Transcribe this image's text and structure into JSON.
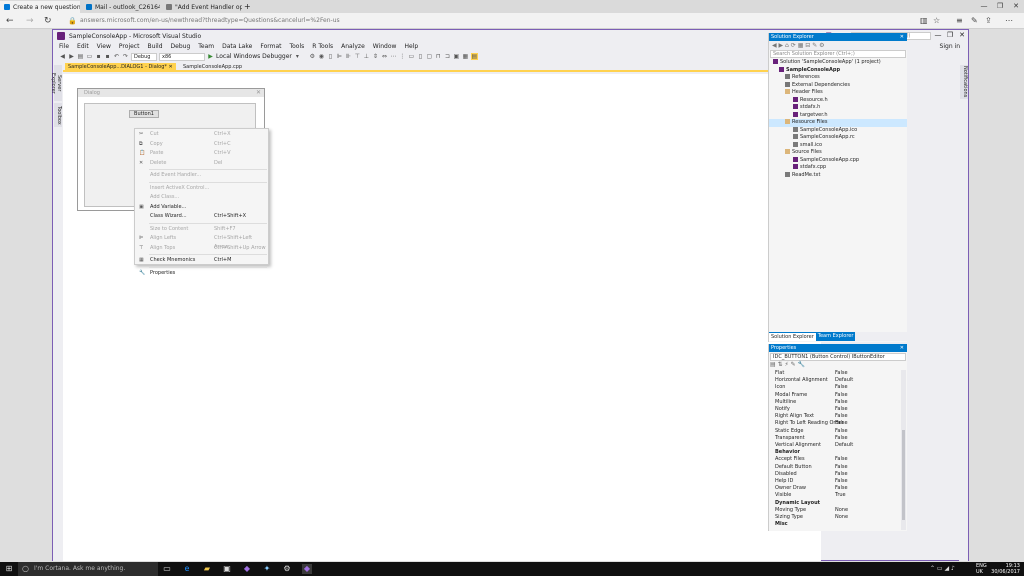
{
  "browser": {
    "tabs": [
      {
        "label": "Create a new question o",
        "color": "#0078d7"
      },
      {
        "label": "Mail - outlook_C261642784",
        "color": "#0072c6"
      },
      {
        "label": "\"Add Event Handler option",
        "color": "#777777"
      }
    ],
    "new_tab": "+",
    "url": "answers.microsoft.com/en-us/newthread?threadtype=Questions&cancelurl=%2Fen-us",
    "win_controls": [
      "—",
      "❐",
      "✕"
    ]
  },
  "vs": {
    "title": "SampleConsoleApp - Microsoft Visual Studio",
    "quick_launch": "Quick Launch (Ctrl+Q)",
    "sign_in": "Sign in",
    "menu": [
      "File",
      "Edit",
      "View",
      "Project",
      "Build",
      "Debug",
      "Team",
      "Data Lake",
      "Format",
      "Tools",
      "R Tools",
      "Analyze",
      "Window",
      "Help"
    ],
    "toolbar": {
      "config": "Debug",
      "platform": "x86",
      "run": "Local Windows Debugger"
    },
    "side_tabs": [
      "Server Explorer",
      "Toolbox"
    ],
    "right_tab": "Notifications",
    "doc_tabs": [
      "SampleConsoleApp...DIALOG1 - Dialog*",
      "SampleConsoleApp.cpp"
    ],
    "dialog": {
      "title": "Dialog",
      "button": "Button1"
    },
    "context_menu": [
      {
        "label": "Cut",
        "shortcut": "Ctrl+X",
        "disabled": true,
        "icon": "✂"
      },
      {
        "label": "Copy",
        "shortcut": "Ctrl+C",
        "disabled": true,
        "icon": "⧉"
      },
      {
        "label": "Paste",
        "shortcut": "Ctrl+V",
        "disabled": true,
        "icon": "📋"
      },
      {
        "label": "Delete",
        "shortcut": "Del",
        "disabled": true,
        "icon": "✕"
      },
      {
        "sep": true
      },
      {
        "label": "Add Event Handler...",
        "shortcut": "",
        "disabled": true,
        "icon": ""
      },
      {
        "sep": true
      },
      {
        "label": "Insert ActiveX Control...",
        "shortcut": "",
        "disabled": true,
        "icon": ""
      },
      {
        "label": "Add Class...",
        "shortcut": "",
        "disabled": true,
        "icon": ""
      },
      {
        "label": "Add Variable...",
        "shortcut": "",
        "disabled": false,
        "icon": "▣"
      },
      {
        "label": "Class Wizard...",
        "shortcut": "Ctrl+Shift+X",
        "disabled": false,
        "icon": ""
      },
      {
        "sep": true
      },
      {
        "label": "Size to Content",
        "shortcut": "Shift+F7",
        "disabled": true,
        "icon": ""
      },
      {
        "label": "Align Lefts",
        "shortcut": "Ctrl+Shift+Left Arrow",
        "disabled": true,
        "icon": "⊫"
      },
      {
        "label": "Align Tops",
        "shortcut": "Ctrl+Shift+Up Arrow",
        "disabled": true,
        "icon": "⊤"
      },
      {
        "sep": true
      },
      {
        "label": "Check Mnemonics",
        "shortcut": "Ctrl+M",
        "disabled": false,
        "icon": "▦"
      },
      {
        "sep": true
      },
      {
        "label": "Properties",
        "shortcut": "",
        "disabled": false,
        "icon": "🔧"
      }
    ],
    "solution_explorer": {
      "title": "Solution Explorer",
      "search": "Search Solution Explorer (Ctrl+;)",
      "tree": [
        {
          "label": "Solution 'SampleConsoleApp' (1 project)",
          "level": 0,
          "color": "#68217a",
          "bold": false,
          "sel": false
        },
        {
          "label": "SampleConsoleApp",
          "level": 1,
          "color": "#68217a",
          "bold": true,
          "sel": false
        },
        {
          "label": "References",
          "level": 2,
          "color": "#777777",
          "bold": false,
          "sel": false
        },
        {
          "label": "External Dependencies",
          "level": 2,
          "color": "#777777",
          "bold": false,
          "sel": false
        },
        {
          "label": "Header Files",
          "level": 2,
          "color": "#dcb67a",
          "bold": false,
          "sel": false
        },
        {
          "label": "Resource.h",
          "level": 3,
          "color": "#68217a",
          "bold": false,
          "sel": false
        },
        {
          "label": "stdafx.h",
          "level": 3,
          "color": "#68217a",
          "bold": false,
          "sel": false
        },
        {
          "label": "targetver.h",
          "level": 3,
          "color": "#68217a",
          "bold": false,
          "sel": false
        },
        {
          "label": "Resource Files",
          "level": 2,
          "color": "#dcb67a",
          "bold": false,
          "sel": true
        },
        {
          "label": "SampleConsoleApp.ico",
          "level": 3,
          "color": "#7a7a7a",
          "bold": false,
          "sel": false
        },
        {
          "label": "SampleConsoleApp.rc",
          "level": 3,
          "color": "#7a7a7a",
          "bold": false,
          "sel": false
        },
        {
          "label": "small.ico",
          "level": 3,
          "color": "#7a7a7a",
          "bold": false,
          "sel": false
        },
        {
          "label": "Source Files",
          "level": 2,
          "color": "#dcb67a",
          "bold": false,
          "sel": false
        },
        {
          "label": "SampleConsoleApp.cpp",
          "level": 3,
          "color": "#68217a",
          "bold": false,
          "sel": false
        },
        {
          "label": "stdafx.cpp",
          "level": 3,
          "color": "#68217a",
          "bold": false,
          "sel": false
        },
        {
          "label": "ReadMe.txt",
          "level": 2,
          "color": "#7a7a7a",
          "bold": false,
          "sel": false
        }
      ],
      "tabs": [
        "Solution Explorer",
        "Team Explorer"
      ]
    },
    "properties": {
      "title": "Properties",
      "object": "IDC_BUTTON1 (Button Control)  IButtonEditor",
      "rows": [
        {
          "name": "Flat",
          "value": "False"
        },
        {
          "name": "Horizontal Alignment",
          "value": "Default"
        },
        {
          "name": "Icon",
          "value": "False"
        },
        {
          "name": "Modal Frame",
          "value": "False"
        },
        {
          "name": "Multiline",
          "value": "False"
        },
        {
          "name": "Notify",
          "value": "False"
        },
        {
          "name": "Right Align Text",
          "value": "False"
        },
        {
          "name": "Right To Left Reading Order",
          "value": "False"
        },
        {
          "name": "Static Edge",
          "value": "False"
        },
        {
          "name": "Transparent",
          "value": "False"
        },
        {
          "name": "Vertical Alignment",
          "value": "Default"
        },
        {
          "name": "Behavior",
          "value": "",
          "cat": true
        },
        {
          "name": "Accept Files",
          "value": "False"
        },
        {
          "name": "Default Button",
          "value": "False"
        },
        {
          "name": "Disabled",
          "value": "False"
        },
        {
          "name": "Help ID",
          "value": "False"
        },
        {
          "name": "Owner Draw",
          "value": "False"
        },
        {
          "name": "Visible",
          "value": "True"
        },
        {
          "name": "Dynamic Layout",
          "value": "",
          "cat": true
        },
        {
          "name": "Moving Type",
          "value": "None"
        },
        {
          "name": "Sizing Type",
          "value": "None"
        },
        {
          "name": "Misc",
          "value": "",
          "cat": true
        }
      ]
    }
  },
  "taskbar": {
    "search": "I'm Cortana. Ask me anything.",
    "lang": "ENG",
    "region": "UK",
    "time": "19:13",
    "date": "30/06/2017"
  }
}
